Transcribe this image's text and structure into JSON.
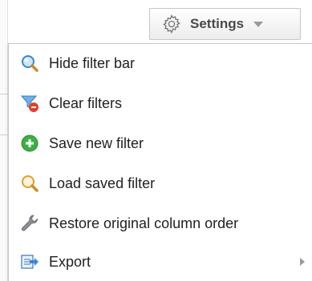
{
  "toolbar": {
    "settings_label": "Settings",
    "settings_icon": "gear-icon",
    "caret_icon": "chevron-down-icon"
  },
  "menu": {
    "items": [
      {
        "label": "Hide filter bar",
        "icon": "magnifier-blue-icon"
      },
      {
        "label": "Clear filters",
        "icon": "filter-clear-icon"
      },
      {
        "label": "Save new filter",
        "icon": "add-circle-icon"
      },
      {
        "label": "Load saved filter",
        "icon": "magnifier-orange-icon"
      },
      {
        "label": "Restore original column order",
        "icon": "wrench-icon"
      },
      {
        "label": "Export",
        "icon": "export-icon",
        "has_submenu": true
      }
    ]
  },
  "colors": {
    "menu_text": "#1f1f1f",
    "button_text": "#4a4a4a",
    "border": "#c8c8c8",
    "save_green": "#3fae45",
    "clear_red": "#e0402a",
    "search_blue": "#3a86d4",
    "search_orange": "#e49b2f"
  }
}
